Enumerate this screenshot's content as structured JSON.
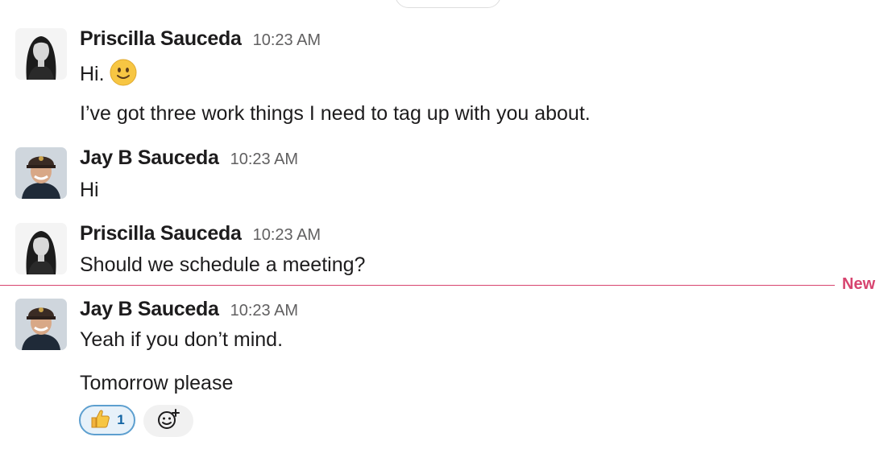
{
  "messages": [
    {
      "author": "Priscilla Sauceda",
      "time": "10:23 AM",
      "lines": [
        "Hi.",
        "I’ve got three work things I need to tag up with you about."
      ]
    },
    {
      "author": "Jay B Sauceda",
      "time": "10:23 AM",
      "lines": [
        "Hi"
      ]
    },
    {
      "author": "Priscilla Sauceda",
      "time": "10:23 AM",
      "lines": [
        "Should we schedule a meeting?"
      ]
    },
    {
      "author": "Jay B Sauceda",
      "time": "10:23 AM",
      "lines": [
        "Yeah if you don’t mind.",
        "Tomorrow please"
      ]
    }
  ],
  "new_divider": {
    "label": "New",
    "color": "#d7446f"
  },
  "reactions": [
    {
      "icon": "thumbs-up-icon",
      "count": "1"
    }
  ],
  "icons": {
    "smile": "slightly-smiling-face-icon",
    "add_reaction": "add-reaction-icon"
  },
  "colors": {
    "reaction_border": "#5d9fcf",
    "reaction_bg": "#e7f1f9",
    "reaction_count": "#1264a3"
  }
}
